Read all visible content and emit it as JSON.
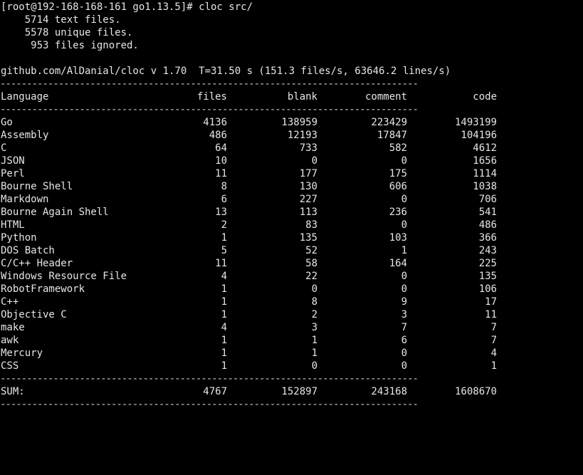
{
  "prompt": "[root@192-168-168-161 go1.13.5]# cloc src/",
  "counts": [
    "    5714 text files.",
    "    5578 unique files.",
    "     953 files ignored."
  ],
  "summary_line": "github.com/AlDanial/cloc v 1.70  T=31.50 s (151.3 files/s, 63646.2 lines/s)",
  "separator": "-------------------------------------------------------------------------------",
  "headers": [
    "Language",
    "files",
    "blank",
    "comment",
    "code"
  ],
  "rows": [
    [
      "Go",
      "4136",
      "138959",
      "223429",
      "1493199"
    ],
    [
      "Assembly",
      "486",
      "12193",
      "17847",
      "104196"
    ],
    [
      "C",
      "64",
      "733",
      "582",
      "4612"
    ],
    [
      "JSON",
      "10",
      "0",
      "0",
      "1656"
    ],
    [
      "Perl",
      "11",
      "177",
      "175",
      "1114"
    ],
    [
      "Bourne Shell",
      "8",
      "130",
      "606",
      "1038"
    ],
    [
      "Markdown",
      "6",
      "227",
      "0",
      "706"
    ],
    [
      "Bourne Again Shell",
      "13",
      "113",
      "236",
      "541"
    ],
    [
      "HTML",
      "2",
      "83",
      "0",
      "486"
    ],
    [
      "Python",
      "1",
      "135",
      "103",
      "366"
    ],
    [
      "DOS Batch",
      "5",
      "52",
      "1",
      "243"
    ],
    [
      "C/C++ Header",
      "11",
      "58",
      "164",
      "225"
    ],
    [
      "Windows Resource File",
      "4",
      "22",
      "0",
      "135"
    ],
    [
      "RobotFramework",
      "1",
      "0",
      "0",
      "106"
    ],
    [
      "C++",
      "1",
      "8",
      "9",
      "17"
    ],
    [
      "Objective C",
      "1",
      "2",
      "3",
      "11"
    ],
    [
      "make",
      "4",
      "3",
      "7",
      "7"
    ],
    [
      "awk",
      "1",
      "1",
      "6",
      "7"
    ],
    [
      "Mercury",
      "1",
      "1",
      "0",
      "4"
    ],
    [
      "CSS",
      "1",
      "0",
      "0",
      "1"
    ]
  ],
  "sum": [
    "SUM:",
    "4767",
    "152897",
    "243168",
    "1608670"
  ],
  "colors": {
    "background": "#000000",
    "text": "#e6e6e6"
  }
}
